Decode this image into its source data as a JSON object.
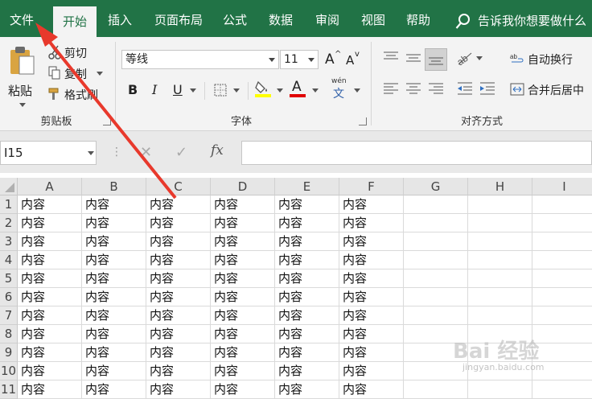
{
  "tabs": [
    {
      "label": "文件"
    },
    {
      "label": "开始"
    },
    {
      "label": "插入"
    },
    {
      "label": "页面布局"
    },
    {
      "label": "公式"
    },
    {
      "label": "数据"
    },
    {
      "label": "审阅"
    },
    {
      "label": "视图"
    },
    {
      "label": "帮助"
    }
  ],
  "tell_me": "告诉我你想要做什么",
  "clipboard": {
    "paste": "粘贴",
    "cut": "剪切",
    "copy": "复制",
    "format_painter": "格式刷",
    "group": "剪贴板"
  },
  "font": {
    "name": "等线",
    "size": "11",
    "grow": "A",
    "shrink": "A",
    "bold": "B",
    "italic": "I",
    "underline": "U",
    "font_color_letter": "A",
    "phonetic_top": "wén",
    "phonetic_bottom": "文",
    "group": "字体"
  },
  "alignment": {
    "wrap": "自动换行",
    "merge": "合并后居中",
    "group": "对齐方式"
  },
  "formula_bar": {
    "name_box": "I15",
    "cancel": "✕",
    "enter": "✓",
    "fx": "fx",
    "value": ""
  },
  "sheet": {
    "columns": [
      "A",
      "B",
      "C",
      "D",
      "E",
      "F",
      "G",
      "H",
      "I"
    ],
    "rows": [
      "1",
      "2",
      "3",
      "4",
      "5",
      "6",
      "7",
      "8",
      "9",
      "10",
      "11"
    ],
    "cell_text": "内容"
  },
  "watermark": {
    "text": "Bai 经验",
    "sub": "jingyan.baidu.com"
  },
  "colors": {
    "accent": "#217346",
    "arrow": "#e8392c"
  }
}
